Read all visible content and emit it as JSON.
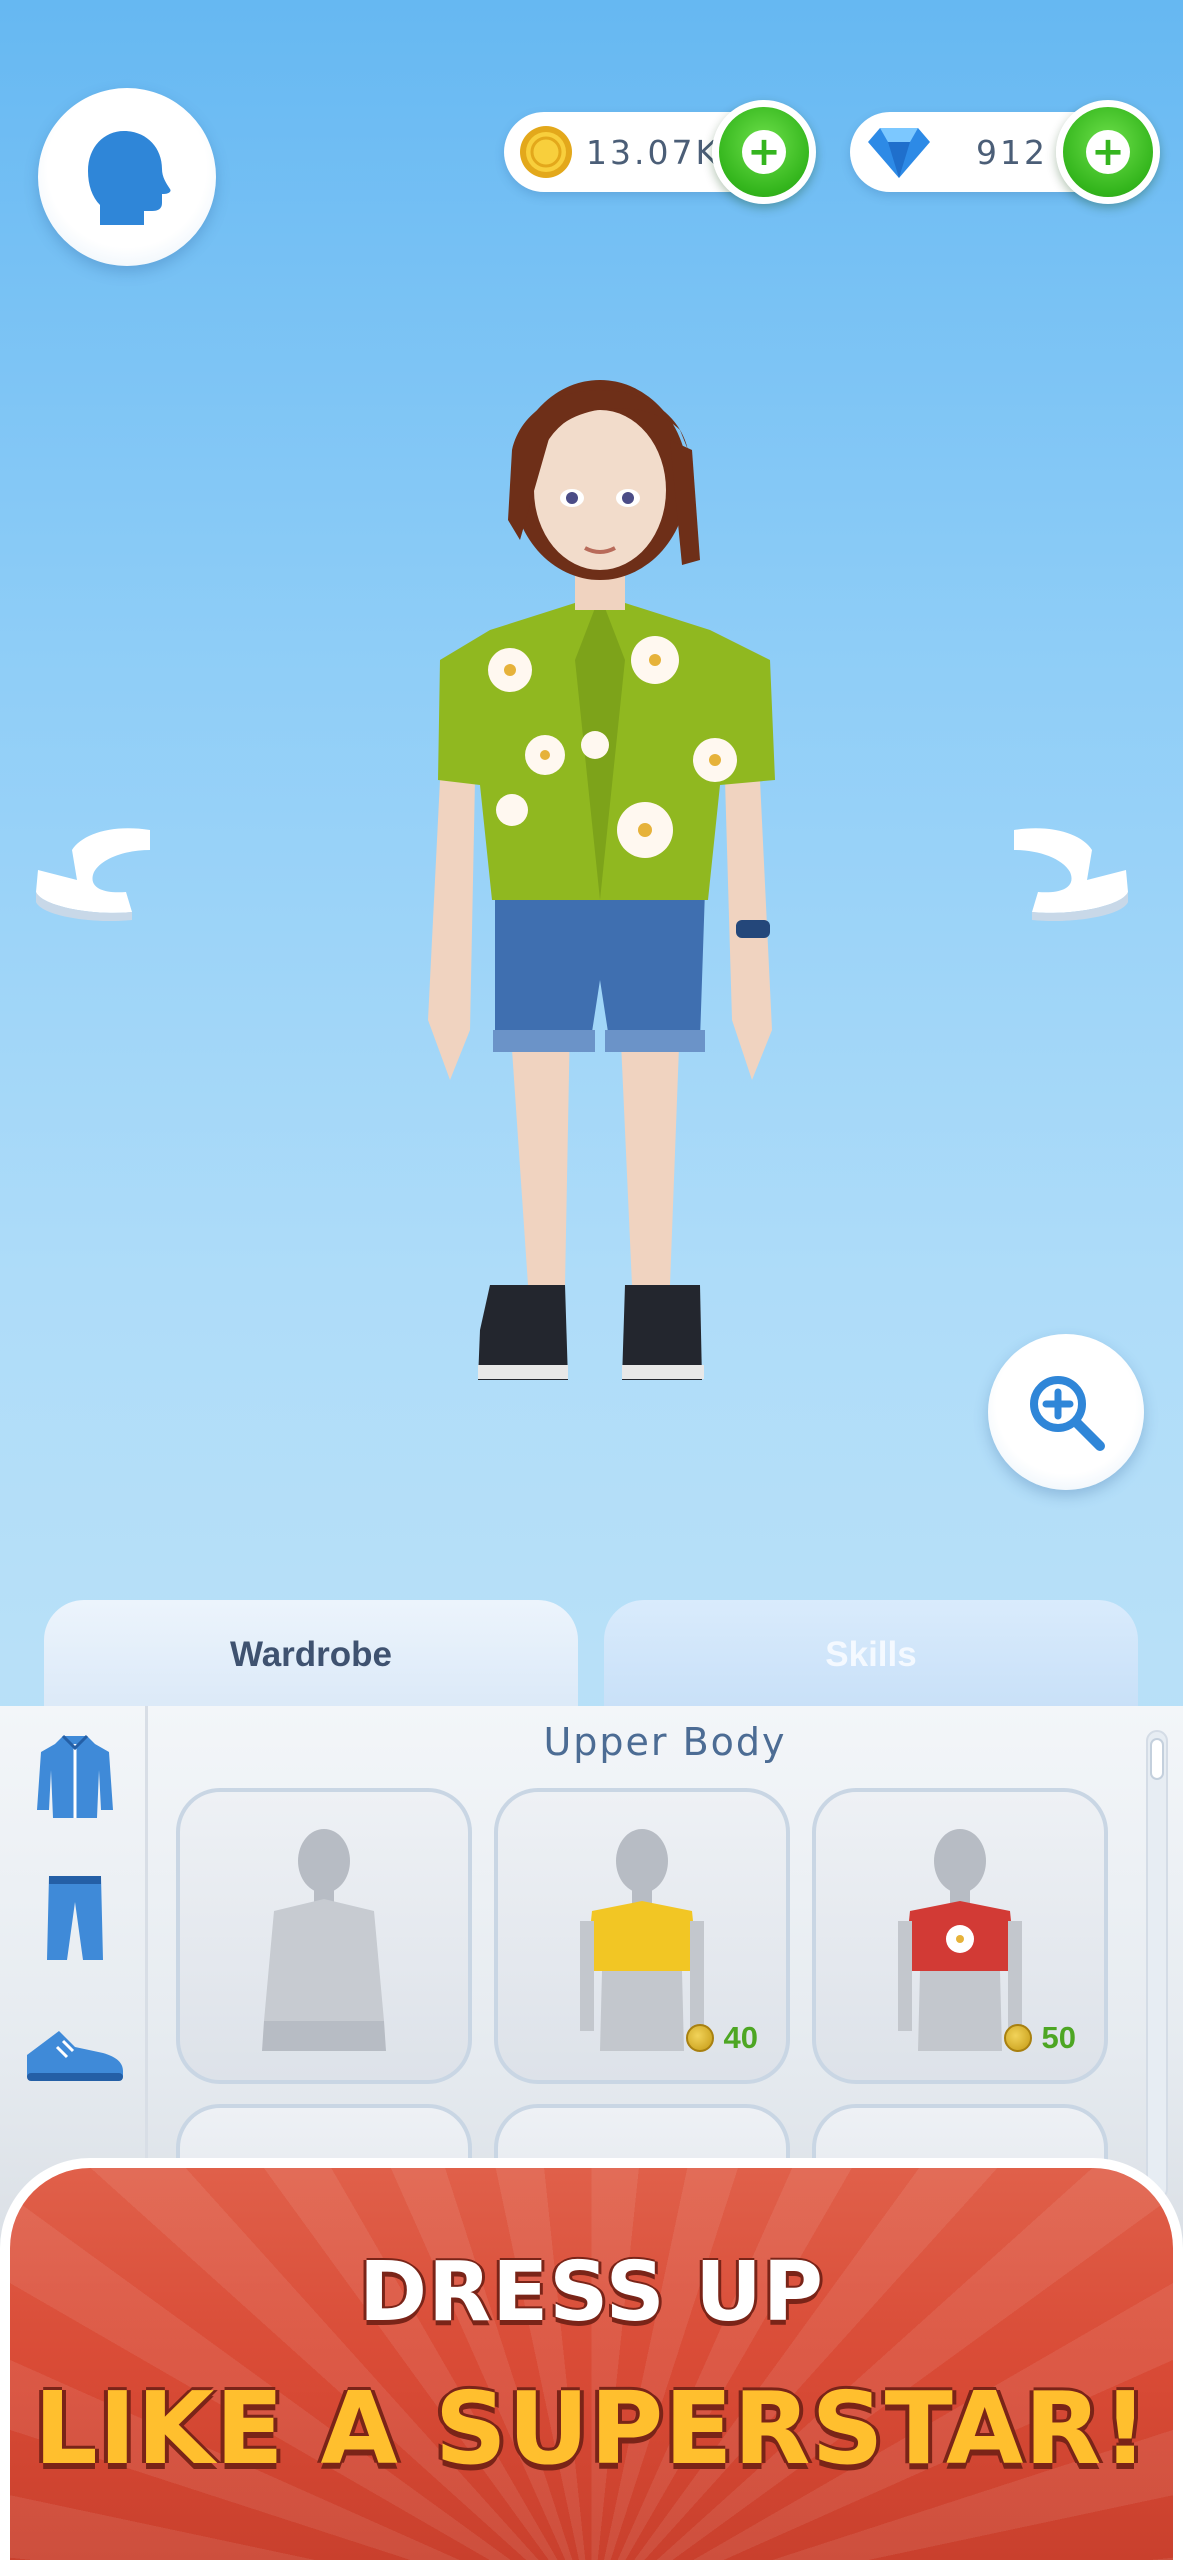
{
  "header": {
    "profile_icon": "head-profile-icon",
    "coins": {
      "icon": "gold-coin-icon",
      "value": "13.07K",
      "add_icon": "plus-icon"
    },
    "gems": {
      "icon": "diamond-icon",
      "value": "912",
      "add_icon": "plus-icon"
    }
  },
  "avatar": {
    "rotate_left_icon": "rotate-left-arrow-icon",
    "rotate_right_icon": "rotate-right-arrow-icon",
    "zoom_icon": "zoom-in-icon"
  },
  "tabs": [
    {
      "label": "Wardrobe",
      "active": true
    },
    {
      "label": "Skills",
      "active": false
    }
  ],
  "categories": [
    {
      "icon": "jacket-icon"
    },
    {
      "icon": "pants-icon"
    },
    {
      "icon": "shoe-icon"
    }
  ],
  "wardrobe": {
    "section_title": "Upper Body",
    "items": [
      {
        "name": "default-shirt",
        "price": ""
      },
      {
        "name": "yellow-crop-top",
        "price": "40"
      },
      {
        "name": "red-flower-crop-top",
        "price": "50"
      }
    ]
  },
  "banner": {
    "line1": "DRESS UP",
    "line2": "LIKE A SUPERSTAR!"
  },
  "colors": {
    "accent_green": "#33b51c",
    "banner_red": "#d94b36",
    "banner_yellow": "#ffbf2e",
    "icon_blue": "#2f86d8"
  }
}
